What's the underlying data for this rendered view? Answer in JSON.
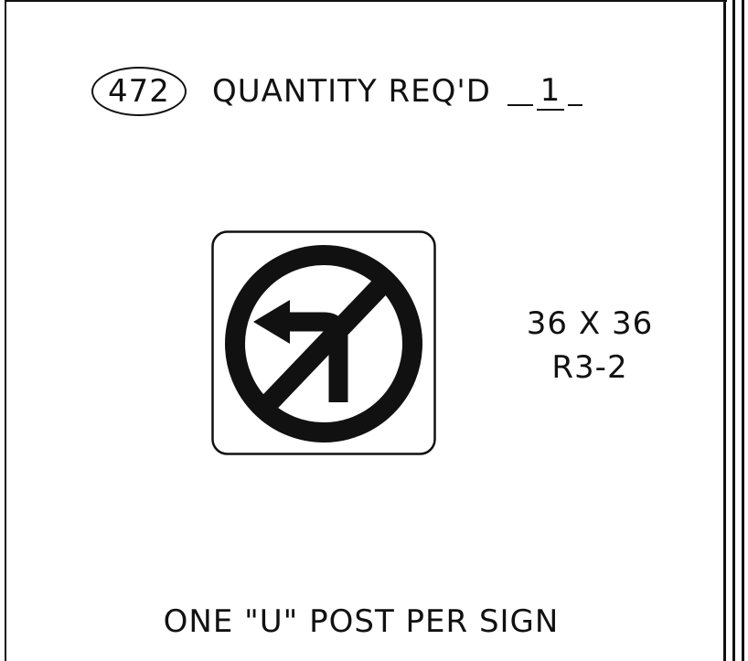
{
  "header": {
    "item_number": "472",
    "quantity_label": "QUANTITY REQ'D",
    "quantity_value": "1"
  },
  "sign": {
    "icon": "no-left-turn-sign-icon",
    "size": "36 X 36",
    "code": "R3-2"
  },
  "footer": {
    "note": "ONE \"U\" POST PER SIGN"
  }
}
